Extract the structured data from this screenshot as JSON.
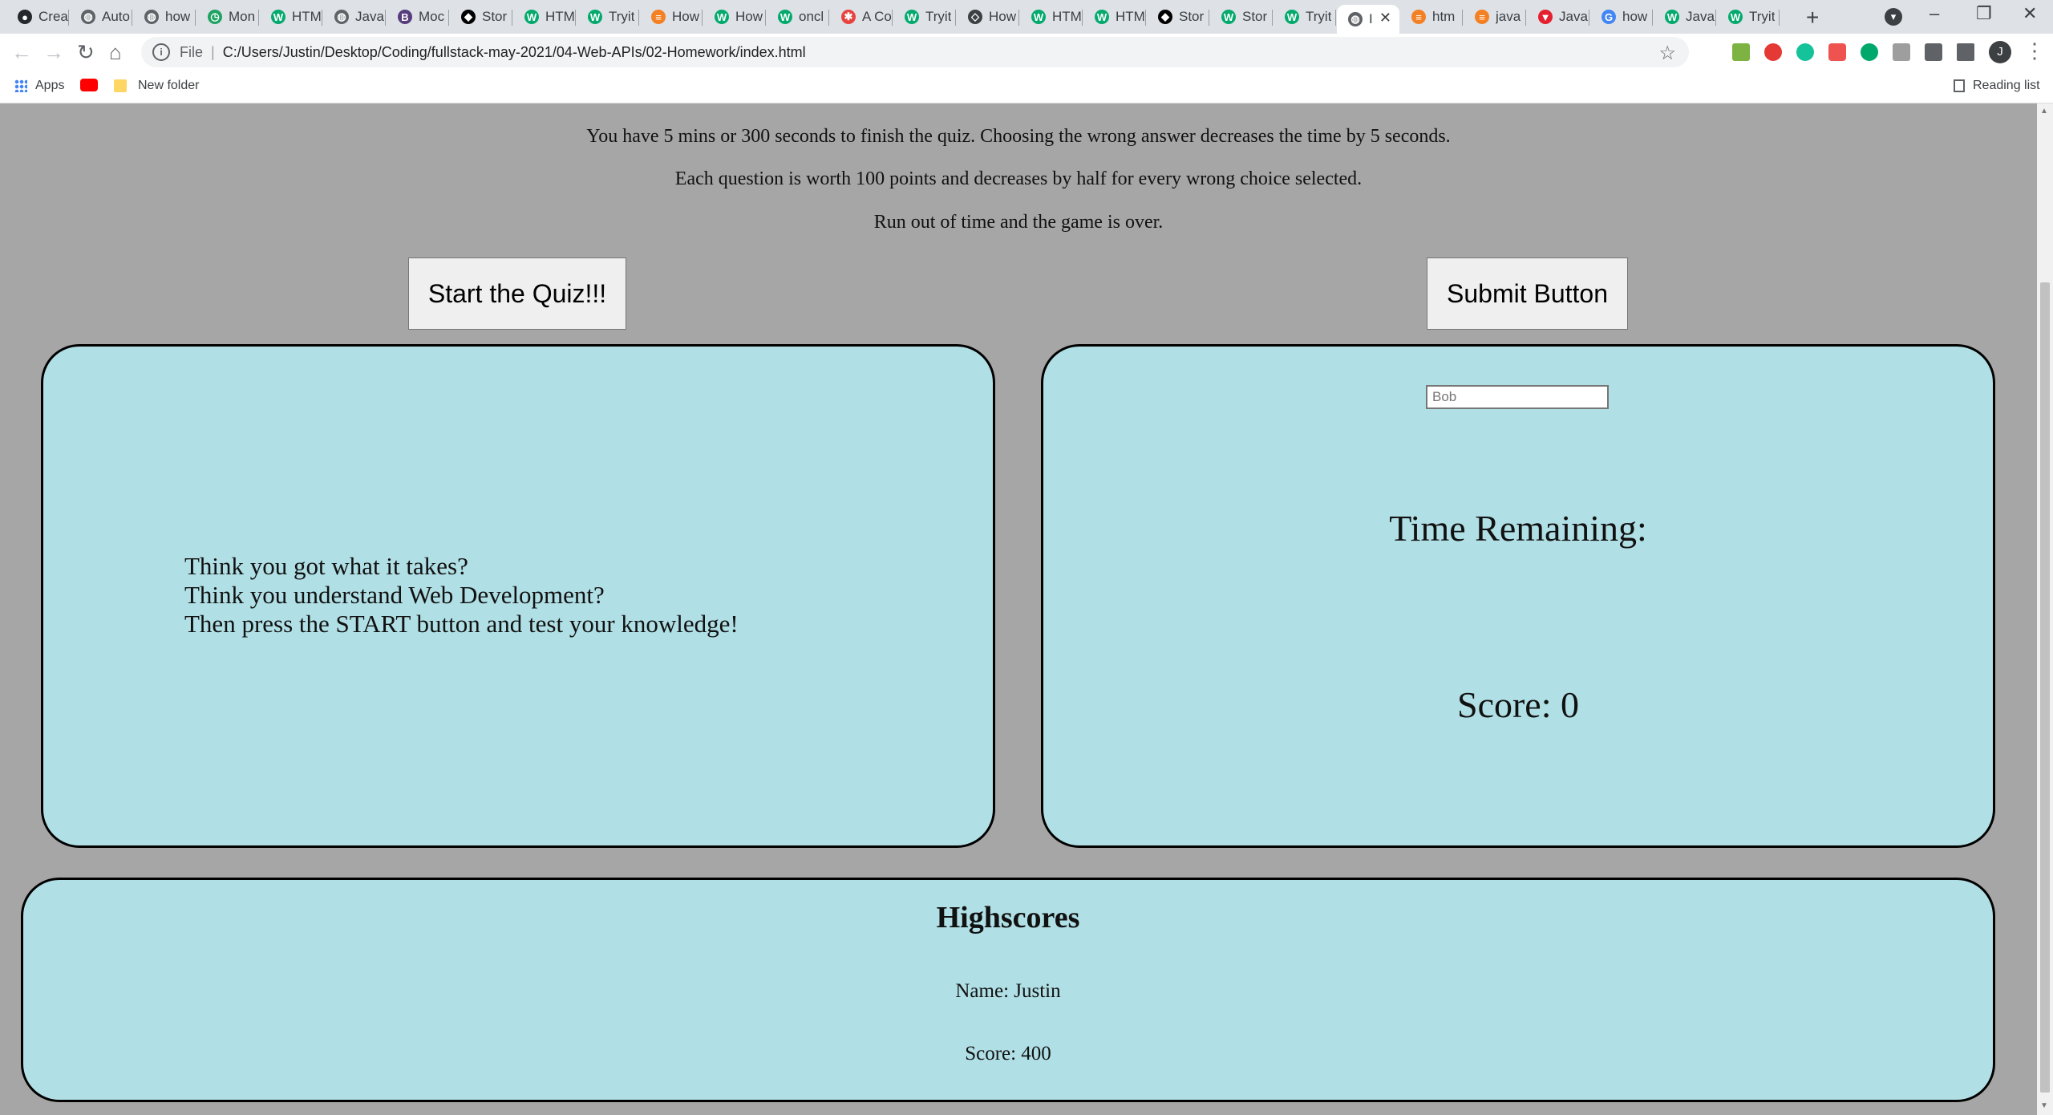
{
  "tabs": [
    {
      "label": "Crea",
      "icon": "github-icon",
      "color": "#24292e"
    },
    {
      "label": "Auto",
      "icon": "globe-icon",
      "color": "#5f6368"
    },
    {
      "label": "how",
      "icon": "globe-icon",
      "color": "#5f6368"
    },
    {
      "label": "Mon",
      "icon": "clock-icon",
      "color": "#1ea362"
    },
    {
      "label": "HTM",
      "icon": "w3schools-icon",
      "color": "#04aa6d"
    },
    {
      "label": "Java",
      "icon": "globe-icon",
      "color": "#5f6368"
    },
    {
      "label": "Moc",
      "icon": "bootstrap-icon",
      "color": "#563d7c"
    },
    {
      "label": "Stor",
      "icon": "codepen-icon",
      "color": "#000000"
    },
    {
      "label": "HTM",
      "icon": "w3schools-icon",
      "color": "#04aa6d"
    },
    {
      "label": "Tryit",
      "icon": "w3schools-icon",
      "color": "#04aa6d"
    },
    {
      "label": "How",
      "icon": "stackoverflow-icon",
      "color": "#f48024"
    },
    {
      "label": "How",
      "icon": "w3schools-icon",
      "color": "#04aa6d"
    },
    {
      "label": "oncl",
      "icon": "w3schools-icon",
      "color": "#04aa6d"
    },
    {
      "label": "A Co",
      "icon": "asterisk-icon",
      "color": "#e8423f"
    },
    {
      "label": "Tryit",
      "icon": "w3schools-icon",
      "color": "#04aa6d"
    },
    {
      "label": "How",
      "icon": "diamond-icon",
      "color": "#3c4043"
    },
    {
      "label": "HTM",
      "icon": "w3schools-icon",
      "color": "#04aa6d"
    },
    {
      "label": "HTM",
      "icon": "w3schools-icon",
      "color": "#04aa6d"
    },
    {
      "label": "Stor",
      "icon": "codepen-icon",
      "color": "#000000"
    },
    {
      "label": "Stor",
      "icon": "w3schools-icon",
      "color": "#04aa6d"
    },
    {
      "label": "Tryit",
      "icon": "w3schools-icon",
      "color": "#04aa6d"
    },
    {
      "label": "I",
      "icon": "globe-icon",
      "color": "#5f6368",
      "active": true
    },
    {
      "label": "htm",
      "icon": "stackoverflow-icon",
      "color": "#f48024"
    },
    {
      "label": "java",
      "icon": "stackoverflow-icon",
      "color": "#f48024"
    },
    {
      "label": "Java",
      "icon": "vue-icon",
      "color": "#e4202e"
    },
    {
      "label": "how",
      "icon": "google-icon",
      "color": "#4285f4"
    },
    {
      "label": "Java",
      "icon": "w3schools-icon",
      "color": "#04aa6d"
    },
    {
      "label": "Tryit",
      "icon": "w3schools-icon",
      "color": "#04aa6d"
    }
  ],
  "browser": {
    "scheme": "File",
    "url": "C:/Users/Justin/Desktop/Coding/fullstack-may-2021/04-Web-APIs/02-Homework/index.html",
    "profile_initial": "J",
    "bookmarks": {
      "apps": "Apps",
      "folder": "New folder",
      "reading_list": "Reading list"
    }
  },
  "page": {
    "intro_lines": [
      "You have 5 mins or 300 seconds to finish the quiz. Choosing the wrong answer decreases the time by 5 seconds.",
      "Each question is worth 100 points and decreases by half for every wrong choice selected.",
      "Run out of time and the game is over."
    ],
    "start_button": "Start the Quiz!!!",
    "submit_button": "Submit Button",
    "quiz_intro": [
      "Think you got what it takes?",
      "Think you understand Web Development?",
      "Then press the START button and test your knowledge!"
    ],
    "name_input_placeholder": "Bob",
    "time_remaining": "Time Remaining:",
    "score": "Score: 0",
    "highscores": {
      "title": "Highscores",
      "name": "Name: Justin",
      "score": "Score: 400"
    }
  },
  "colors": {
    "page_bg": "#a6a6a6",
    "panel_bg": "#b0dfe5"
  }
}
